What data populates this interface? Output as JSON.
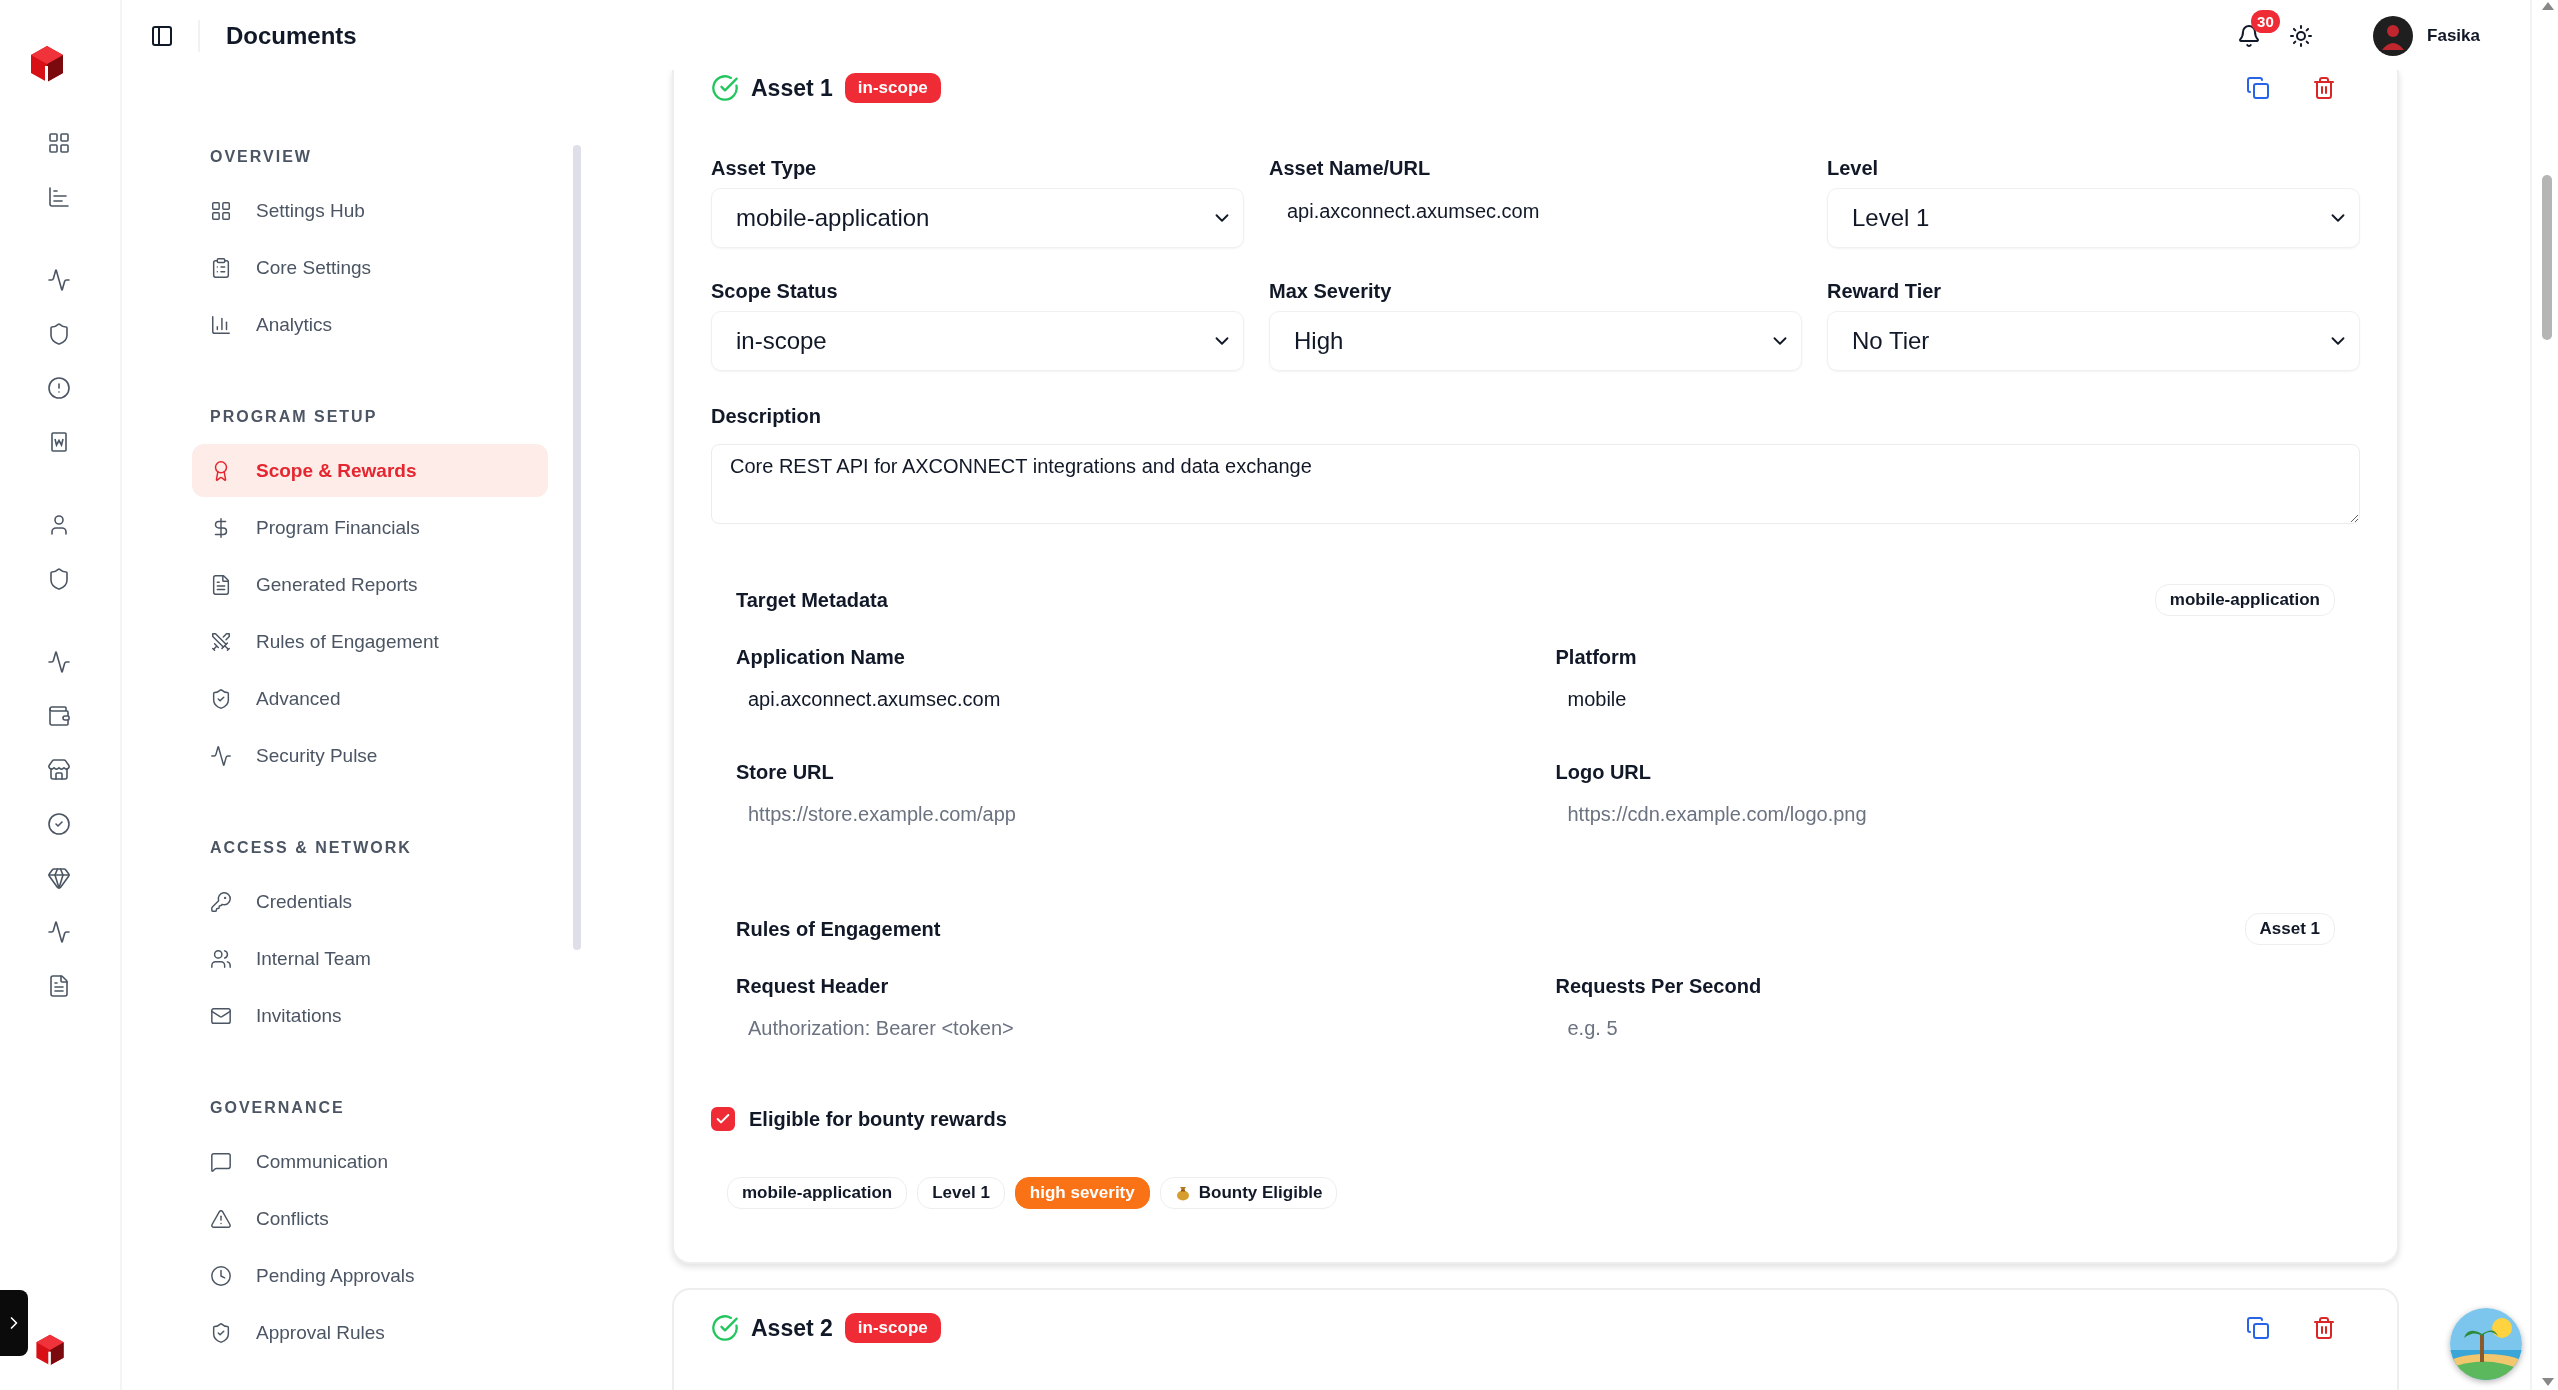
{
  "header": {
    "title": "Documents",
    "notifications": "30",
    "user": "Fasika"
  },
  "sidebar": {
    "sections": [
      {
        "title": "OVERVIEW",
        "items": [
          {
            "label": "Settings Hub",
            "selected": false
          },
          {
            "label": "Core Settings",
            "selected": false
          },
          {
            "label": "Analytics",
            "selected": false
          }
        ]
      },
      {
        "title": "PROGRAM SETUP",
        "items": [
          {
            "label": "Scope & Rewards",
            "selected": true
          },
          {
            "label": "Program Financials",
            "selected": false
          },
          {
            "label": "Generated Reports",
            "selected": false
          },
          {
            "label": "Rules of Engagement",
            "selected": false
          },
          {
            "label": "Advanced",
            "selected": false
          },
          {
            "label": "Security Pulse",
            "selected": false
          }
        ]
      },
      {
        "title": "ACCESS & NETWORK",
        "items": [
          {
            "label": "Credentials",
            "selected": false
          },
          {
            "label": "Internal Team",
            "selected": false
          },
          {
            "label": "Invitations",
            "selected": false
          }
        ]
      },
      {
        "title": "GOVERNANCE",
        "items": [
          {
            "label": "Communication",
            "selected": false
          },
          {
            "label": "Conflicts",
            "selected": false
          },
          {
            "label": "Pending Approvals",
            "selected": false
          },
          {
            "label": "Approval Rules",
            "selected": false
          }
        ]
      }
    ]
  },
  "assets": [
    {
      "title": "Asset 1",
      "status": "in-scope",
      "fields": [
        {
          "label": "Asset Type",
          "kind": "select",
          "value": "mobile-application"
        },
        {
          "label": "Asset Name/URL",
          "kind": "text",
          "value": "api.axconnect.axumsec.com"
        },
        {
          "label": "Level",
          "kind": "select",
          "value": "Level 1"
        },
        {
          "label": "Scope Status",
          "kind": "select",
          "value": "in-scope"
        },
        {
          "label": "Max Severity",
          "kind": "select",
          "value": "High"
        },
        {
          "label": "Reward Tier",
          "kind": "select",
          "value": "No Tier"
        }
      ],
      "description": {
        "label": "Description",
        "value": "Core REST API for AXCONNECT integrations and data exchange"
      },
      "panels": [
        {
          "title": "Target Metadata",
          "badge": "mobile-application",
          "fields": [
            {
              "label": "Application Name",
              "value": "api.axconnect.axumsec.com"
            },
            {
              "label": "Platform",
              "value": "mobile"
            },
            {
              "label": "Store URL",
              "placeholder": "https://store.example.com/app"
            },
            {
              "label": "Logo URL",
              "placeholder": "https://cdn.example.com/logo.png"
            }
          ]
        },
        {
          "title": "Rules of Engagement",
          "badge": "Asset 1",
          "fields": [
            {
              "label": "Request Header",
              "placeholder": "Authorization: Bearer <token>"
            },
            {
              "label": "Requests Per Second",
              "placeholder": "e.g. 5"
            }
          ]
        }
      ],
      "eligible": {
        "label": "Eligible for bounty rewards",
        "checked": true
      },
      "tags": [
        {
          "label": "mobile-application",
          "kind": "plain"
        },
        {
          "label": "Level 1",
          "kind": "plain"
        },
        {
          "label": "high severity",
          "kind": "severity"
        },
        {
          "label": "Bounty Eligible",
          "kind": "bounty"
        }
      ]
    },
    {
      "title": "Asset 2",
      "status": "in-scope"
    }
  ]
}
